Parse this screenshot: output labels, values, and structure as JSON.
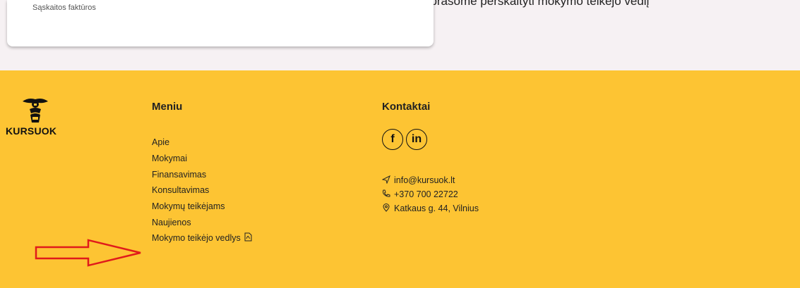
{
  "top": {
    "card_text": "Sąskaitos faktūros",
    "tail_text": ", prašome perskaityti mokymo teikėjo vedlį"
  },
  "footer": {
    "logo_text": "KURSUOK",
    "menu_title": "Meniu",
    "menu_items": [
      "Apie",
      "Mokymai",
      "Finansavimas",
      "Konsultavimas",
      "Mokymų teikėjams",
      "Naujienos",
      "Mokymo teikėjo vedlys"
    ],
    "contacts_title": "Kontaktai",
    "socials": [
      {
        "label": "f",
        "icon": "facebook-icon"
      },
      {
        "label": "in",
        "icon": "linkedin-icon"
      }
    ],
    "contacts": {
      "email": "info@kursuok.lt",
      "phone": "+370 700 22722",
      "address": "Katkaus g. 44, Vilnius"
    }
  },
  "colors": {
    "footer_bg": "#fdc433",
    "top_bg": "#f6f1f3",
    "annotation_arrow": "#e01b1b",
    "link_underline": "#2b6b8a"
  }
}
